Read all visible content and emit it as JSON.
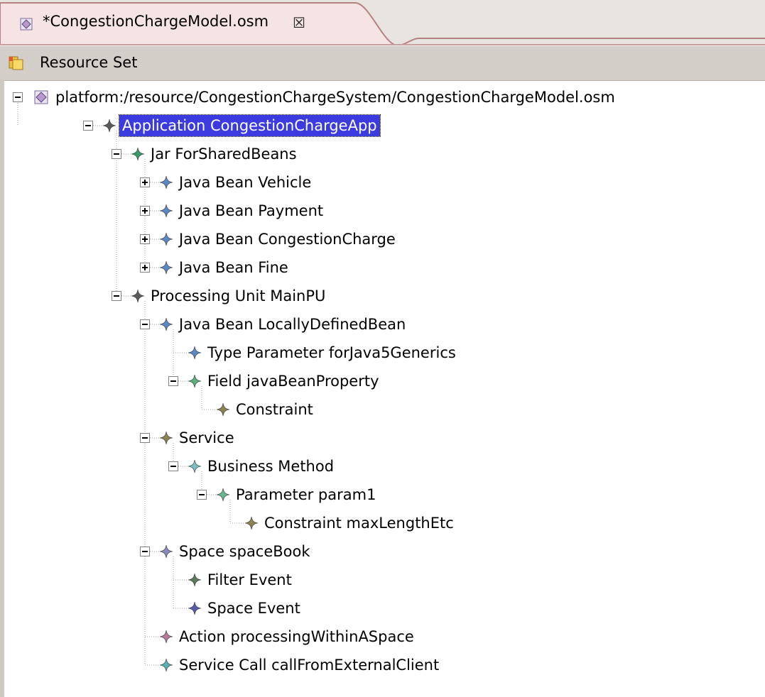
{
  "editor_tab": {
    "title": "*CongestionChargeModel.osm",
    "close_glyph": "☒",
    "icon": "model-file-icon"
  },
  "resource_set": {
    "label": "Resource Set",
    "icon": "resource-set-icon"
  },
  "tree": {
    "root": {
      "label": "platform:/resource/CongestionChargeSystem/CongestionChargeModel.osm",
      "icon": "model-file-icon"
    },
    "nodes": [
      {
        "label": "Application CongestionChargeApp",
        "color": "#5a5a5a",
        "selected": true,
        "expand": "minus"
      },
      {
        "label": "Jar ForSharedBeans",
        "color": "#3a9a6a",
        "expand": "minus"
      },
      {
        "label": "Java Bean Vehicle",
        "color": "#5a8ac6",
        "expand": "plus"
      },
      {
        "label": "Java Bean Payment",
        "color": "#5a8ac6",
        "expand": "plus"
      },
      {
        "label": "Java Bean CongestionCharge",
        "color": "#5a8ac6",
        "expand": "plus"
      },
      {
        "label": "Java Bean Fine",
        "color": "#5a8ac6",
        "expand": "plus"
      },
      {
        "label": "Processing Unit MainPU",
        "color": "#5a5a5a",
        "expand": "minus"
      },
      {
        "label": "Java Bean LocallyDefinedBean",
        "color": "#5a8ac6",
        "expand": "minus"
      },
      {
        "label": "Type Parameter forJava5Generics",
        "color": "#5a8ac6",
        "expand": "none"
      },
      {
        "label": "Field javaBeanProperty",
        "color": "#5ab07a",
        "expand": "minus"
      },
      {
        "label": "Constraint",
        "color": "#8c8450",
        "expand": "none"
      },
      {
        "label": "Service",
        "color": "#8c8450",
        "expand": "minus"
      },
      {
        "label": "Business Method",
        "color": "#7ac0c0",
        "expand": "minus"
      },
      {
        "label": "Parameter param1",
        "color": "#6ab890",
        "expand": "minus"
      },
      {
        "label": "Constraint maxLengthEtc",
        "color": "#8c8450",
        "expand": "none"
      },
      {
        "label": "Space spaceBook",
        "color": "#8a8ab8",
        "expand": "minus"
      },
      {
        "label": "Filter Event",
        "color": "#5a7a5a",
        "expand": "none"
      },
      {
        "label": "Space Event",
        "color": "#5a5aaa",
        "expand": "none"
      },
      {
        "label": "Action processingWithinASpace",
        "color": "#b87a9a",
        "expand": "none"
      },
      {
        "label": "Service Call callFromExternalClient",
        "color": "#5ab0b0",
        "expand": "none"
      }
    ]
  }
}
